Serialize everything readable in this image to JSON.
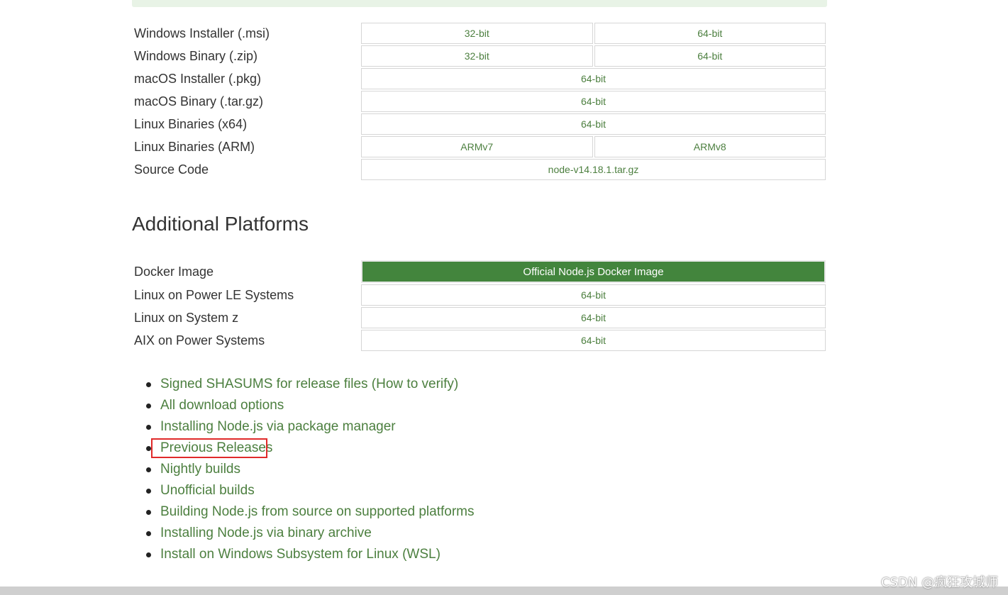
{
  "downloads": [
    {
      "label": "Windows Installer (.msi)",
      "options": [
        "32-bit",
        "64-bit"
      ]
    },
    {
      "label": "Windows Binary (.zip)",
      "options": [
        "32-bit",
        "64-bit"
      ]
    },
    {
      "label": "macOS Installer (.pkg)",
      "options": [
        "64-bit"
      ]
    },
    {
      "label": "macOS Binary (.tar.gz)",
      "options": [
        "64-bit"
      ]
    },
    {
      "label": "Linux Binaries (x64)",
      "options": [
        "64-bit"
      ]
    },
    {
      "label": "Linux Binaries (ARM)",
      "options": [
        "ARMv7",
        "ARMv8"
      ]
    },
    {
      "label": "Source Code",
      "options": [
        "node-v14.18.1.tar.gz"
      ]
    }
  ],
  "additional": {
    "heading": "Additional Platforms",
    "rows": [
      {
        "label": "Docker Image",
        "options": [
          "Official Node.js Docker Image"
        ]
      },
      {
        "label": "Linux on Power LE Systems",
        "options": [
          "64-bit"
        ]
      },
      {
        "label": "Linux on System z",
        "options": [
          "64-bit"
        ]
      },
      {
        "label": "AIX on Power Systems",
        "options": [
          "64-bit"
        ]
      }
    ]
  },
  "links": [
    "Signed SHASUMS for release files (How to verify)",
    "All download options",
    "Installing Node.js via package manager",
    "Previous Releases",
    "Nightly builds",
    "Unofficial builds",
    "Building Node.js from source on supported platforms",
    "Installing Node.js via binary archive",
    "Install on Windows Subsystem for Linux (WSL)"
  ],
  "highlighted_link_index": 3,
  "watermark": "CSDN @疯狂攻城师",
  "colors": {
    "link": "#4c7f3f",
    "primary_button": "#43853d",
    "highlight": "#e02a2a"
  }
}
